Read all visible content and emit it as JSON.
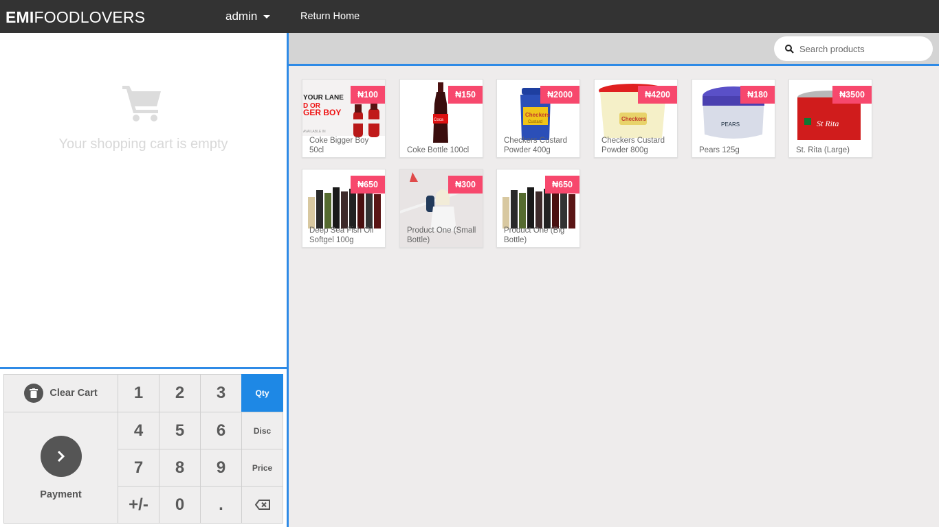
{
  "header": {
    "brand_bold": "EMI",
    "brand_light": "FOODLOVERS",
    "user": "admin",
    "return_home": "Return Home"
  },
  "cart": {
    "empty_message": "Your shopping cart is empty",
    "icon": "shopping-cart-icon"
  },
  "keypad": {
    "clear_cart": "Clear Cart",
    "payment": "Payment",
    "digits": [
      "1",
      "2",
      "3",
      "4",
      "5",
      "6",
      "7",
      "8",
      "9",
      "0"
    ],
    "sign": "+/-",
    "dot": ".",
    "modes": [
      "Qty",
      "Disc",
      "Price"
    ],
    "active_mode": "Qty",
    "backspace_icon": "backspace-icon"
  },
  "search": {
    "placeholder": "Search products",
    "icon": "search-icon"
  },
  "products": [
    {
      "name": "Coke Bigger Boy 50cl",
      "price": "₦100"
    },
    {
      "name": "Coke Bottle 100cl",
      "price": "₦150"
    },
    {
      "name": "Checkers Custard Powder 400g",
      "price": "₦2000"
    },
    {
      "name": "Checkers Custard Powder 800g",
      "price": "₦4200"
    },
    {
      "name": "Pears 125g",
      "price": "₦180"
    },
    {
      "name": "St. Rita (Large)",
      "price": "₦3500"
    },
    {
      "name": "Deep Sea Fish Oil Softgel 100g",
      "price": "₦650"
    },
    {
      "name": "Product One (Small Bottle)",
      "price": "₦300"
    },
    {
      "name": "Product One (Big Bottle)",
      "price": "₦650"
    }
  ],
  "product_images": {
    "ad_text": [
      "YOUR LANE",
      "D OR",
      "GER BOY",
      "AVAILABLE IN"
    ],
    "checkers_label": "Checkers",
    "checkers_sub": "Custard",
    "pears_label": "PEARS",
    "rita_label": "St Rita"
  },
  "colors": {
    "accent": "#1e88e5",
    "price_tag": "#f7486d",
    "topbar": "#333333"
  }
}
